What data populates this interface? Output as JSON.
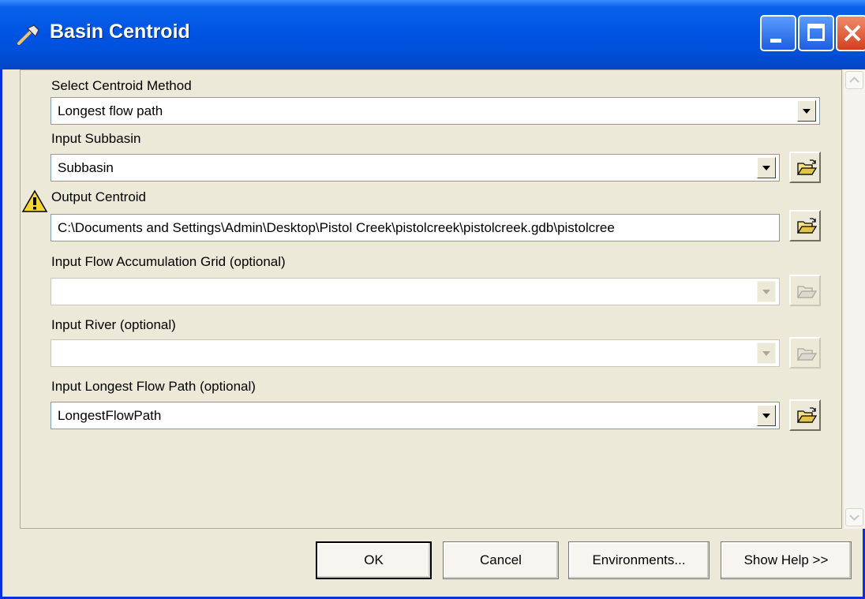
{
  "window": {
    "title": "Basin Centroid",
    "icon": "hammer-icon"
  },
  "form": {
    "fields": [
      {
        "label": "Select Centroid Method",
        "value": "Longest flow path",
        "enabled": true,
        "has_browse": false
      },
      {
        "label": "Input Subbasin",
        "value": "Subbasin",
        "enabled": true,
        "has_browse": true
      },
      {
        "label": "Output Centroid",
        "value": "C:\\Documents and Settings\\Admin\\Desktop\\Pistol Creek\\pistolcreek\\pistolcreek.gdb\\pistolcree",
        "enabled": true,
        "has_browse": true,
        "warning": true
      },
      {
        "label": "Input Flow Accumulation Grid (optional)",
        "value": "",
        "enabled": false,
        "has_browse": true
      },
      {
        "label": "Input River (optional)",
        "value": "",
        "enabled": false,
        "has_browse": true
      },
      {
        "label": "Input Longest Flow Path (optional)",
        "value": "LongestFlowPath",
        "enabled": true,
        "has_browse": true
      }
    ]
  },
  "buttons": {
    "ok": "OK",
    "cancel": "Cancel",
    "environments": "Environments...",
    "show_help": "Show Help >>"
  },
  "colors": {
    "titlebar": "#0054e3",
    "dialog_bg": "#ece9d8",
    "close_button": "#d3401f",
    "warning": "#f7d631"
  }
}
